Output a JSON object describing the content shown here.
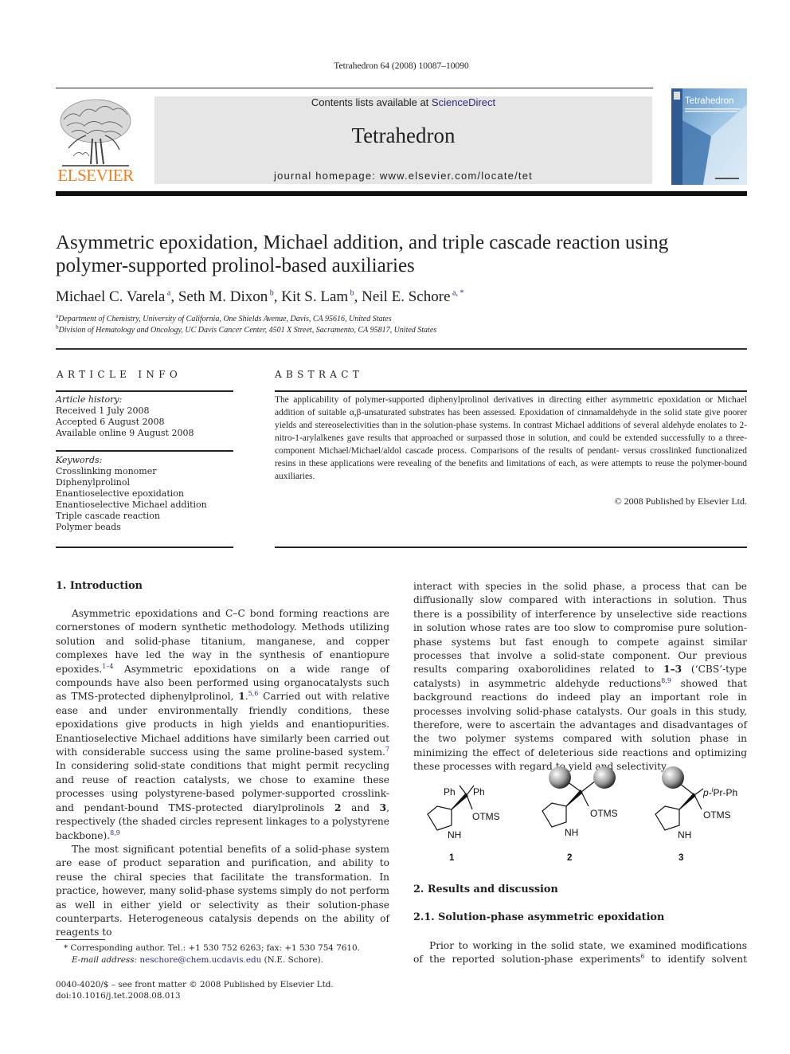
{
  "header": {
    "citation": "Tetrahedron 64 (2008) 10087–10090",
    "contents_prefix": "Contents lists available at ",
    "contents_link": "ScienceDirect",
    "journal_title": "Tetrahedron",
    "homepage": "journal homepage: www.elsevier.com/locate/tet",
    "publisher_logo_text": "ELSEVIER",
    "cover_title": "Tetrahedron",
    "colors": {
      "elsevier_orange": "#f07f1a",
      "link_blue": "#2b2a7b",
      "masthead_gray": "#e6e6e6"
    }
  },
  "article": {
    "title_line1": "Asymmetric epoxidation, Michael addition, and triple cascade reaction using",
    "title_line2": "polymer-supported prolinol-based auxiliaries",
    "authors": [
      {
        "name": "Michael C. Varela",
        "affil": "a",
        "sep": ", "
      },
      {
        "name": "Seth M. Dixon",
        "affil": "b",
        "sep": ", "
      },
      {
        "name": "Kit S. Lam",
        "affil": "b",
        "sep": ", "
      },
      {
        "name": "Neil E. Schore",
        "affil": "a, *",
        "sep": ""
      }
    ],
    "affiliations": [
      {
        "mark": "a",
        "text": "Department of Chemistry, University of California, One Shields Avenue, Davis, CA 95616, United States"
      },
      {
        "mark": "b",
        "text": "Division of Hematology and Oncology, UC Davis Cancer Center, 4501 X Street, Sacramento, CA 95817, United States"
      }
    ]
  },
  "article_info": {
    "heading": "ARTICLE INFO",
    "history_label": "Article history:",
    "history": [
      "Received 1 July 2008",
      "Accepted 6 August 2008",
      "Available online 9 August 2008"
    ],
    "keywords_label": "Keywords:",
    "keywords": [
      "Crosslinking monomer",
      "Diphenylprolinol",
      "Enantioselective epoxidation",
      "Enantioselective Michael addition",
      "Triple cascade reaction",
      "Polymer beads"
    ]
  },
  "abstract": {
    "heading": "ABSTRACT",
    "text": "The applicability of polymer-supported diphenylprolinol derivatives in directing either asymmetric epoxidation or Michael addition of suitable α,β-unsaturated substrates has been assessed. Epoxidation of cinnamaldehyde in the solid state give poorer yields and stereoselectivities than in the solution-phase systems. In contrast Michael additions of several aldehyde enolates to 2-nitro-1-arylalkenes gave results that approached or surpassed those in solution, and could be extended successfully to a three-component Michael/Michael/aldol cascade process. Comparisons of the results of pendant- versus crosslinked functionalized resins in these applications were revealing of the benefits and limitations of each, as were attempts to reuse the polymer-bound auxiliaries.",
    "copyright": "© 2008 Published by Elsevier Ltd."
  },
  "body": {
    "intro_heading": "1.  Introduction",
    "p1": {
      "a": "Asymmetric epoxidations and C–C bond forming reactions are cornerstones of modern synthetic methodology. Methods utilizing solution and solid-phase titanium, manganese, and copper complexes have led the way in the synthesis of enantiopure epoxides.",
      "ref1": "1–4",
      "b": " Asymmetric epoxidations on a wide range of compounds have also been performed using organocatalysts such as TMS-protected diphenylprolinol, ",
      "bold1": "1",
      "c": ".",
      "ref2": "5,6",
      "d": " Carried out with relative ease and under environmentally friendly conditions, these epoxidations give products in high yields and enantiopurities. Enantioselective Michael additions have similarly been carried out with considerable success using the same proline-based system.",
      "ref3": "7",
      "e": " In considering solid-state conditions that might permit recycling and reuse of reaction catalysts, we chose to examine these processes using polystyrene-based polymer-supported crosslink- and pendant-bound TMS-protected diarylprolinols ",
      "bold2": "2",
      "f": " and ",
      "bold3": "3",
      "g": ", respectively (the shaded circles represent linkages to a polystyrene backbone).",
      "ref4": "8,9"
    },
    "p2": "The most significant potential benefits of a solid-phase system are ease of product separation and purification, and ability to reuse the chiral species that facilitate the transformation. In practice, however, many solid-phase systems simply do not perform as well in either yield or selectivity as their solution-phase counterparts. Heterogeneous catalysis depends on the ability of reagents to",
    "p2_cont": {
      "a": "interact with species in the solid phase, a process that can be diffusionally slow compared with interactions in solution. Thus there is a possibility of interference by unselective side reactions in solution whose rates are too slow to compromise pure solution-phase systems but fast enough to compete against similar processes that involve a solid-state component. Our previous results comparing oxaborolidines related to ",
      "bold": "1–3",
      "b": " (‘CBS’-type catalysts) in asymmetric aldehyde reductions",
      "ref": "8,9",
      "c": " showed that background reactions do indeed play an important role in processes involving solid-phase catalysts. Our goals in this study, therefore, were to ascertain the advantages and disadvantages of the two polymer systems compared with solution phase in minimizing the effect of deleterious side reactions and optimizing these processes with regard to yield and selectivity."
    },
    "structures": {
      "s1": {
        "sub1": "Ph",
        "sub2": "Ph",
        "otms": "OTMS",
        "nh": "NH",
        "label": "1"
      },
      "s2": {
        "otms": "OTMS",
        "nh": "NH",
        "label": "2"
      },
      "s3": {
        "sub_prefix": "p-",
        "sub_sup": "i",
        "sub_rest": "Pr-Ph",
        "otms": "OTMS",
        "nh": "NH",
        "label": "3"
      }
    },
    "results_heading": "2.  Results and discussion",
    "sub_heading": "2.1.  Solution-phase asymmetric epoxidation",
    "p3": {
      "a": "Prior to working in the solid state, we examined modifications of the reported solution-phase experiments",
      "ref": "6",
      "b": " to identify solvent"
    }
  },
  "footnotes": {
    "corresponding": "* Corresponding author. Tel.: +1 530 752 6263; fax: +1 530 754 7610.",
    "email_label": "E-mail address: ",
    "email": "neschore@chem.ucdavis.edu",
    "email_suffix": " (N.E. Schore).",
    "issn": "0040-4020/$ – see front matter © 2008 Published by Elsevier Ltd.",
    "doi": "doi:10.1016/j.tet.2008.08.013"
  }
}
